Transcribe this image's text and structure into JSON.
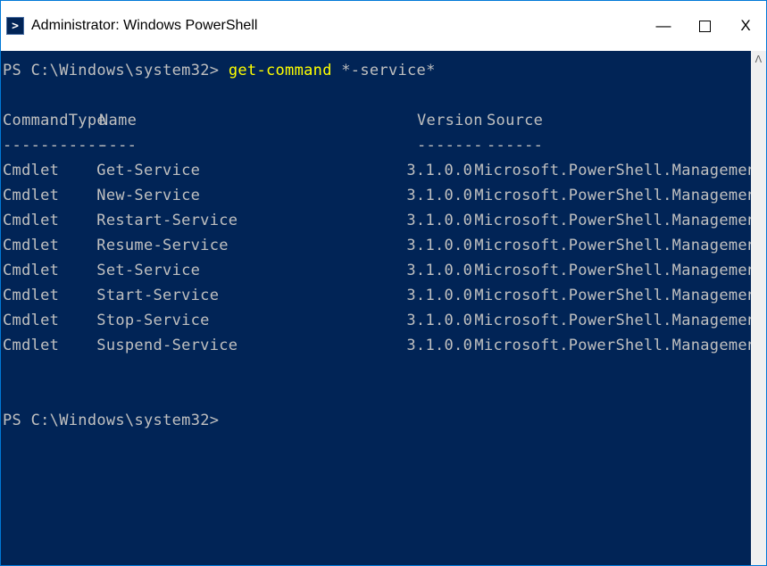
{
  "titlebar": {
    "icon_glyph": ">",
    "title": "Administrator: Windows PowerShell"
  },
  "window_controls": {
    "minimize": "—",
    "close": "X"
  },
  "console": {
    "prompt1_prefix": "PS C:\\Windows\\system32> ",
    "command": "get-command",
    "command_arg": " *-service*",
    "headers": {
      "type": "CommandType",
      "name": "Name",
      "version": "Version",
      "source": "Source"
    },
    "header_dashes": {
      "type": "-----------",
      "name": "----",
      "version": "-------",
      "source": "------"
    },
    "rows": [
      {
        "type": "Cmdlet",
        "name": "Get-Service",
        "version": "3.1.0.0",
        "source": "Microsoft.PowerShell.Management"
      },
      {
        "type": "Cmdlet",
        "name": "New-Service",
        "version": "3.1.0.0",
        "source": "Microsoft.PowerShell.Management"
      },
      {
        "type": "Cmdlet",
        "name": "Restart-Service",
        "version": "3.1.0.0",
        "source": "Microsoft.PowerShell.Management"
      },
      {
        "type": "Cmdlet",
        "name": "Resume-Service",
        "version": "3.1.0.0",
        "source": "Microsoft.PowerShell.Management"
      },
      {
        "type": "Cmdlet",
        "name": "Set-Service",
        "version": "3.1.0.0",
        "source": "Microsoft.PowerShell.Management"
      },
      {
        "type": "Cmdlet",
        "name": "Start-Service",
        "version": "3.1.0.0",
        "source": "Microsoft.PowerShell.Management"
      },
      {
        "type": "Cmdlet",
        "name": "Stop-Service",
        "version": "3.1.0.0",
        "source": "Microsoft.PowerShell.Management"
      },
      {
        "type": "Cmdlet",
        "name": "Suspend-Service",
        "version": "3.1.0.0",
        "source": "Microsoft.PowerShell.Management"
      }
    ],
    "prompt2": "PS C:\\Windows\\system32>"
  }
}
